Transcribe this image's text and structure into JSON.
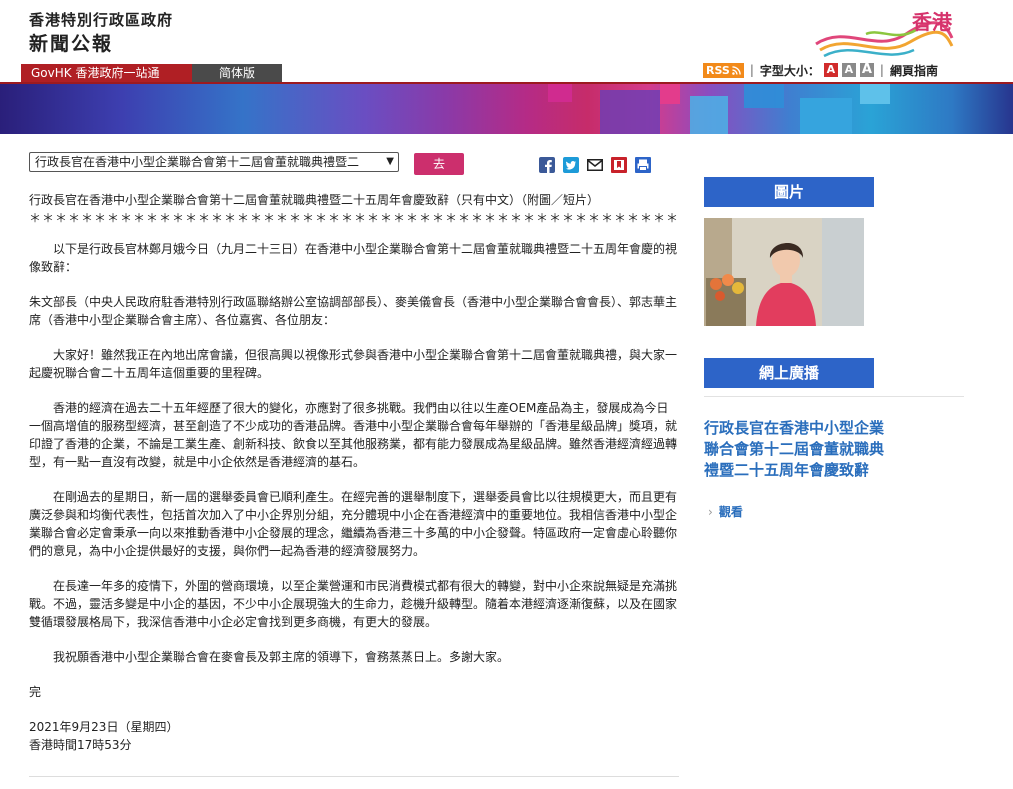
{
  "header": {
    "org": "香港特別行政區政府",
    "title": "新聞公報",
    "logo_text": "香港"
  },
  "nav": {
    "govhk": "GovHK 香港政府一站通",
    "simplified": "简体版",
    "rss": "RSS",
    "font_size_label": "字型大小：",
    "font_sizes": [
      "A",
      "A",
      "A"
    ],
    "guide": "網頁指南"
  },
  "toolbar": {
    "select_value": "行政長官在香港中小型企業聯合會第十二屆會董就職典禮暨二",
    "go": "去"
  },
  "article": {
    "title": "行政長官在香港中小型企業聯合會第十二屆會董就職典禮暨二十五周年會慶致辭（只有中文）（附圖／短片）",
    "stars": "＊＊＊＊＊＊＊＊＊＊＊＊＊＊＊＊＊＊＊＊＊＊＊＊＊＊＊＊＊＊＊＊＊＊＊＊＊＊＊＊＊＊＊＊＊＊＊＊＊＊＊",
    "intro": "以下是行政長官林鄭月娥今日（九月二十三日）在香港中小型企業聯合會第十二屆會董就職典禮暨二十五周年會慶的視像致辭：",
    "salutation": "朱文部長（中央人民政府駐香港特別行政區聯絡辦公室協調部部長）、麥美儀會長（香港中小型企業聯合會會長）、郭志華主席（香港中小型企業聯合會主席）、各位嘉賓、各位朋友：",
    "p1": "大家好！雖然我正在內地出席會議，但很高興以視像形式參與香港中小型企業聯合會第十二屆會董就職典禮，與大家一起慶祝聯合會二十五周年這個重要的里程碑。",
    "p2": "香港的經濟在過去二十五年經歷了很大的變化，亦應對了很多挑戰。我們由以往以生產OEM產品為主，發展成為今日一個高增值的服務型經濟，甚至創造了不少成功的香港品牌。香港中小型企業聯合會每年舉辦的「香港星級品牌」獎項，就印證了香港的企業，不論是工業生產、創新科技、飲食以至其他服務業，都有能力發展成為星級品牌。雖然香港經濟經過轉型，有一點一直沒有改變，就是中小企依然是香港經濟的基石。",
    "p3": "在剛過去的星期日，新一屆的選舉委員會已順利產生。在經完善的選舉制度下，選舉委員會比以往規模更大，而且更有廣泛參與和均衡代表性，包括首次加入了中小企界別分組，充分體現中小企在香港經濟中的重要地位。我相信香港中小型企業聯合會必定會秉承一向以來推動香港中小企發展的理念，繼續為香港三十多萬的中小企發聲。特區政府一定會虛心聆聽你們的意見，為中小企提供最好的支援，與你們一起為香港的經濟發展努力。",
    "p4": "在長達一年多的疫情下，外圍的營商環境，以至企業營運和市民消費模式都有很大的轉變，對中小企來說無疑是充滿挑戰。不過，靈活多變是中小企的基因，不少中小企展現強大的生命力，趁機升級轉型。隨着本港經濟逐漸復蘇，以及在國家雙循環發展格局下，我深信香港中小企必定會找到更多商機，有更大的發展。",
    "p5": "我祝願香港中小型企業聯合會在麥會長及郭主席的領導下，會務蒸蒸日上。多謝大家。",
    "end": "完",
    "date": "2021年9月23日（星期四）",
    "time": "香港時間17時53分"
  },
  "sidebar": {
    "photos_heading": "圖片",
    "webcast_heading": "網上廣播",
    "webcast_title": "行政長官在香港中小型企業聯合會第十二屆會董就職典禮暨二十五周年會慶致辭",
    "watch": "觀看"
  },
  "colors": {
    "nav_red": "#b01f24",
    "go_button": "#cc2f6d",
    "sidebar_heading": "#2d64c8",
    "link_blue": "#2a6ebc",
    "rss_orange": "#f28a1a",
    "font_small": "#d12b2b",
    "font_medium": "#8a8a8a",
    "font_large": "#8a8a8a"
  },
  "icons": [
    "facebook-icon",
    "twitter-icon",
    "email-icon",
    "bookmark-icon",
    "print-icon",
    "rss-feed-icon",
    "chevron-right-icon"
  ]
}
